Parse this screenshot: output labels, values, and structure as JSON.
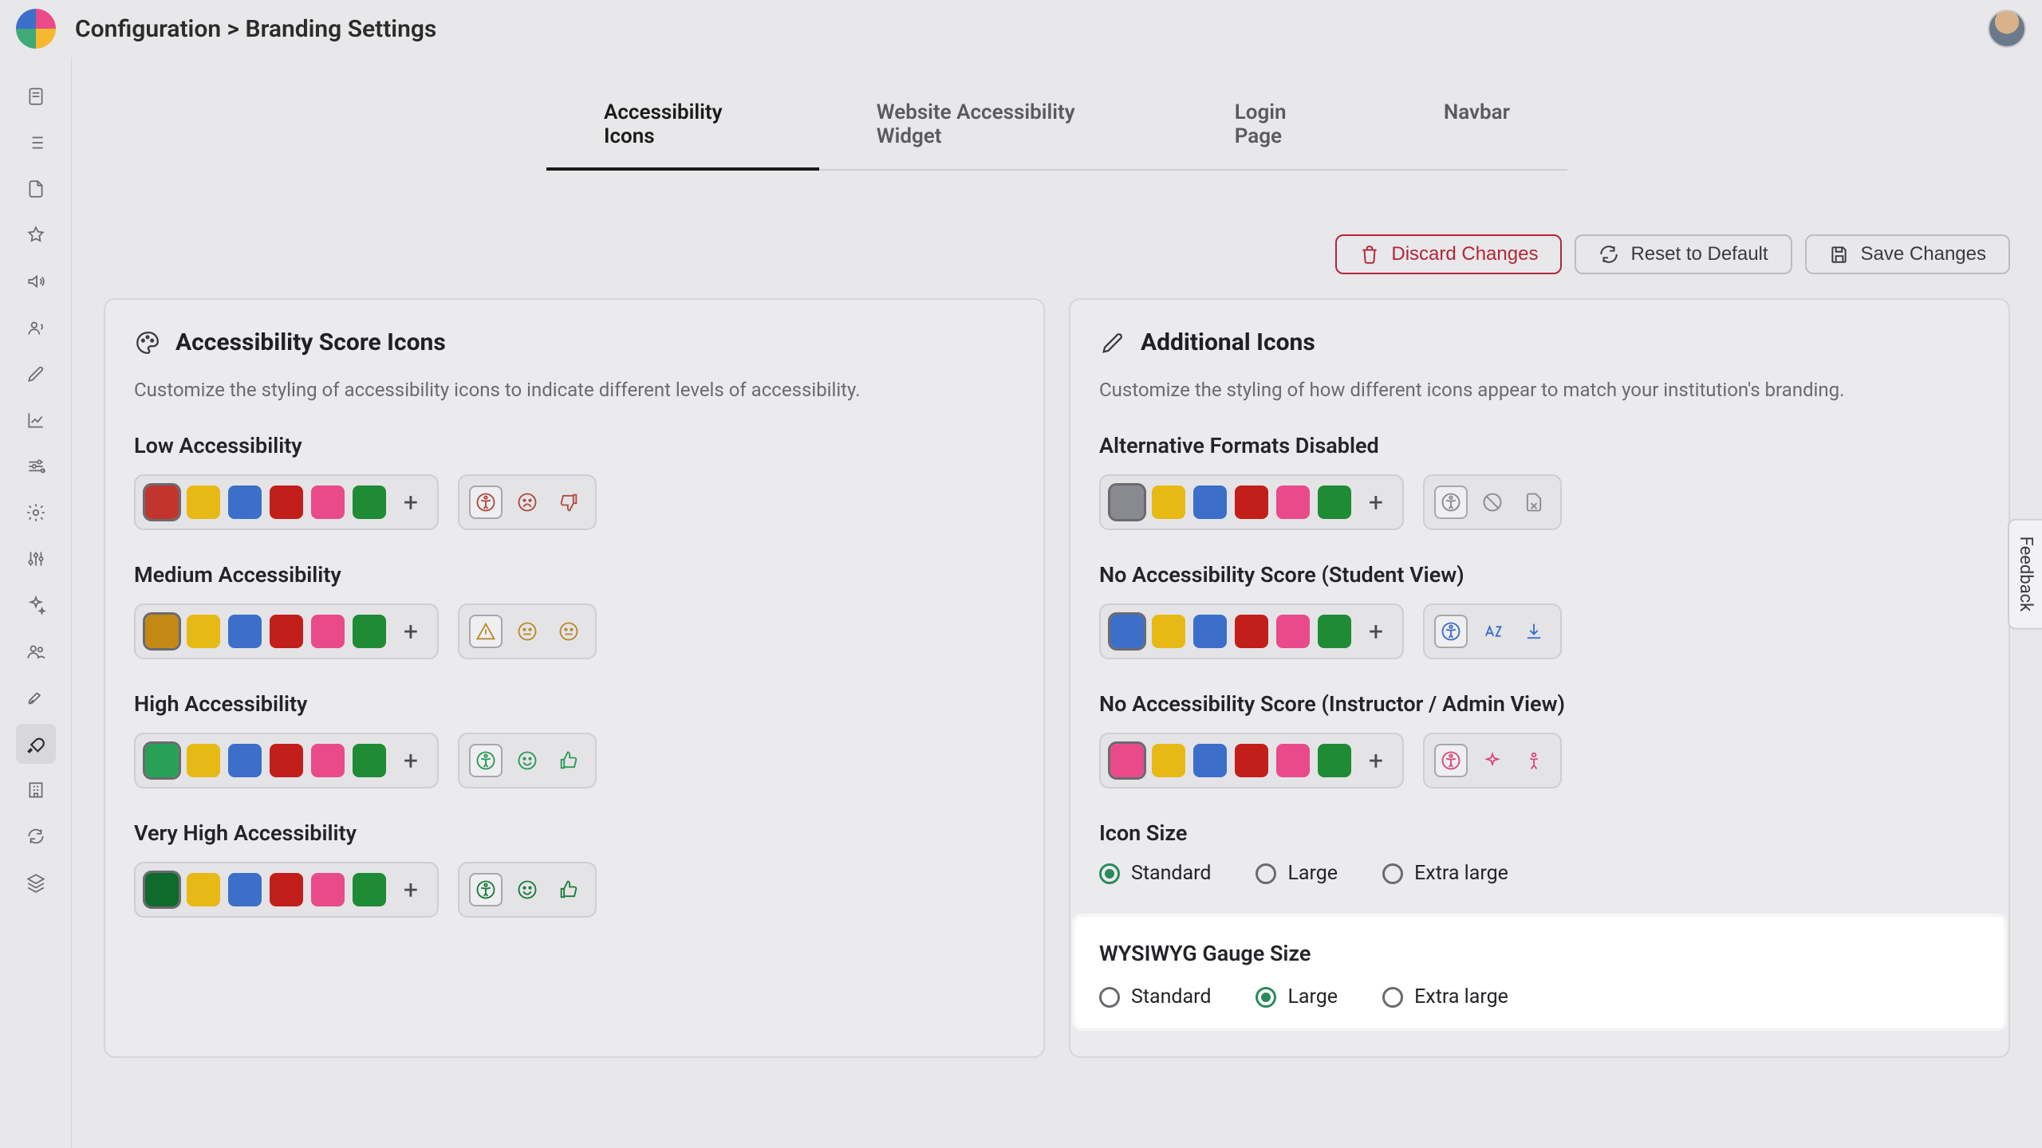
{
  "header": {
    "breadcrumb": "Configuration > Branding Settings"
  },
  "sidebar": {
    "items": [
      {
        "icon": "page-icon"
      },
      {
        "icon": "list-icon"
      },
      {
        "icon": "file-icon"
      },
      {
        "icon": "star-icon"
      },
      {
        "icon": "volume-icon"
      },
      {
        "icon": "user-voice-icon"
      },
      {
        "icon": "pen-icon"
      },
      {
        "icon": "linechart-icon"
      },
      {
        "icon": "sliders-icon"
      },
      {
        "icon": "gear-icon"
      },
      {
        "icon": "tune-icon"
      },
      {
        "icon": "sparkle-icon"
      },
      {
        "icon": "group-icon"
      },
      {
        "icon": "rocket-icon"
      },
      {
        "icon": "paint-icon"
      },
      {
        "icon": "building-icon"
      },
      {
        "icon": "refresh-icon"
      },
      {
        "icon": "layers-icon"
      }
    ],
    "active_index": 14
  },
  "tabs": {
    "items": [
      "Accessibility Icons",
      "Website Accessibility Widget",
      "Login Page",
      "Navbar"
    ],
    "active_index": 0
  },
  "actions": {
    "discard": "Discard Changes",
    "reset": "Reset to Default",
    "save": "Save Changes"
  },
  "palette": {
    "yellow": "#e7b915",
    "blue": "#3b6fc9",
    "red": "#c21f1a",
    "pink": "#e94a8a",
    "green": "#1f8b34"
  },
  "left_card": {
    "title": "Accessibility Score Icons",
    "desc": "Customize the styling of accessibility icons to indicate different levels of accessibility.",
    "sections": [
      {
        "label": "Low Accessibility",
        "selected_color": "#c2342e",
        "icon_color": "#b04a3f"
      },
      {
        "label": "Medium Accessibility",
        "selected_color": "#c48914",
        "icon_color": "#b88a2a"
      },
      {
        "label": "High Accessibility",
        "selected_color": "#28a157",
        "icon_color": "#2a9a55"
      },
      {
        "label": "Very High Accessibility",
        "selected_color": "#0e6b2b",
        "icon_color": "#1a7a3a"
      }
    ]
  },
  "right_card": {
    "title": "Additional Icons",
    "desc": "Customize the styling of how different icons appear to match your institution's branding.",
    "sections": [
      {
        "label": "Alternative Formats Disabled",
        "selected_color": "#898990",
        "icon_color": "#898990"
      },
      {
        "label": "No Accessibility Score (Student View)",
        "selected_color": "#3b6fc9",
        "icon_color": "#3b6fc9"
      },
      {
        "label": "No Accessibility Score (Instructor / Admin View)",
        "selected_color": "#e94a8a",
        "icon_color": "#d64a7a"
      }
    ],
    "icon_size": {
      "label": "Icon Size",
      "options": [
        "Standard",
        "Large",
        "Extra large"
      ],
      "selected": 0
    },
    "gauge_size": {
      "label": "WYSIWYG Gauge Size",
      "options": [
        "Standard",
        "Large",
        "Extra large"
      ],
      "selected": 1
    }
  },
  "feedback_label": "Feedback"
}
